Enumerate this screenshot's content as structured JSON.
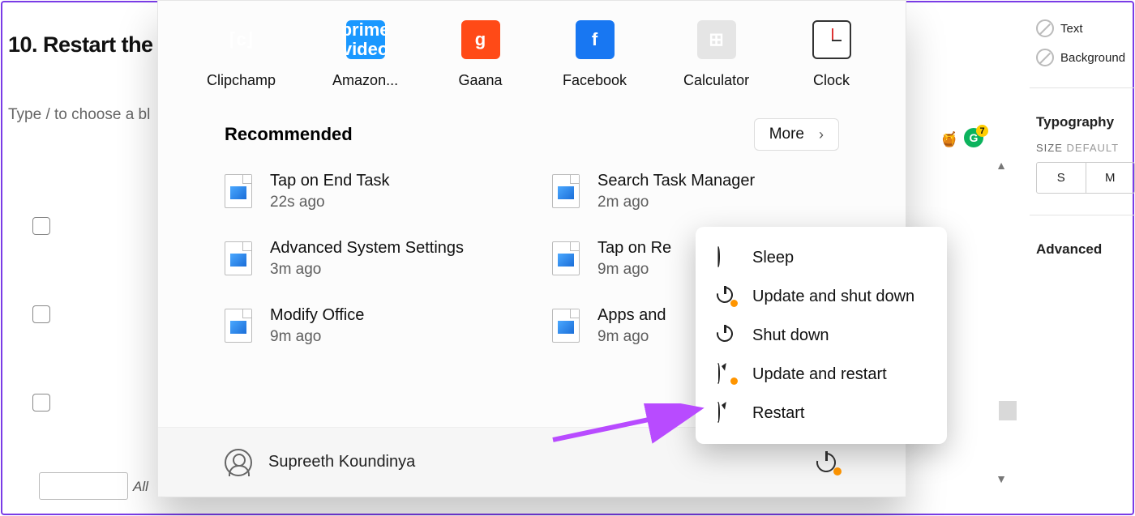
{
  "left": {
    "heading": "10. Restart the",
    "placeholder_line": "Type / to choose a bl",
    "all_label": "All"
  },
  "right": {
    "text_opt": "Text",
    "bg_opt": "Background",
    "typography": "Typography",
    "size_label": "SIZE",
    "size_default": "DEFAULT",
    "tabs": [
      "S",
      "M"
    ],
    "advanced": "Advanced",
    "badge_letter": "G",
    "badge_count": "7"
  },
  "start": {
    "pinned": [
      {
        "label": "Clipchamp",
        "icon": "clip"
      },
      {
        "label": "Amazon...",
        "icon": "prime",
        "glyph": "prime\nvideo"
      },
      {
        "label": "Gaana",
        "icon": "gaana",
        "glyph": "g"
      },
      {
        "label": "Facebook",
        "icon": "fb",
        "glyph": "f"
      },
      {
        "label": "Calculator",
        "icon": "calc",
        "glyph": "⊞"
      },
      {
        "label": "Clock",
        "icon": "clock"
      }
    ],
    "recommended_title": "Recommended",
    "more_label": "More",
    "recommended": [
      {
        "title": "Tap on End Task",
        "time": "22s ago"
      },
      {
        "title": "Search Task Manager",
        "time": "2m ago"
      },
      {
        "title": "Advanced System Settings",
        "time": "3m ago"
      },
      {
        "title": "Tap on Re",
        "time": "9m ago"
      },
      {
        "title": "Modify Office",
        "time": "9m ago"
      },
      {
        "title": "Apps and",
        "time": "9m ago"
      }
    ],
    "user_name": "Supreeth Koundinya"
  },
  "power_menu": {
    "items": [
      {
        "label": "Sleep",
        "icon": "sleep"
      },
      {
        "label": "Update and shut down",
        "icon": "power-dot"
      },
      {
        "label": "Shut down",
        "icon": "power"
      },
      {
        "label": "Update and restart",
        "icon": "restart-dot"
      },
      {
        "label": "Restart",
        "icon": "restart"
      }
    ]
  }
}
